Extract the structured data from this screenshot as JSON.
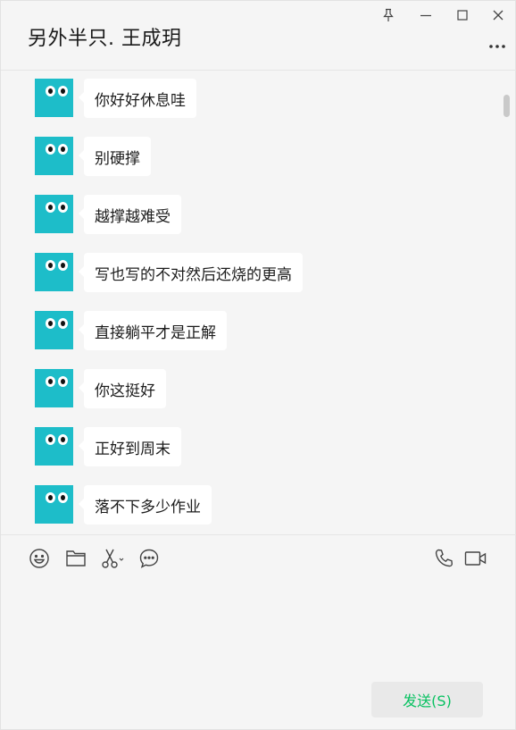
{
  "header": {
    "title": "另外半只. 王成玥",
    "pin_icon": "pin-icon",
    "minimize_icon": "minimize-icon",
    "maximize_icon": "maximize-icon",
    "close_icon": "close-icon",
    "more_icon": "more-icon"
  },
  "messages": [
    {
      "text": "你好好休息哇"
    },
    {
      "text": "别硬撑"
    },
    {
      "text": "越撑越难受"
    },
    {
      "text": "写也写的不对然后还烧的更高"
    },
    {
      "text": "直接躺平才是正解"
    },
    {
      "text": "你这挺好"
    },
    {
      "text": "正好到周末"
    },
    {
      "text": "落不下多少作业"
    }
  ],
  "toolbar": {
    "emoji_icon": "emoji-icon",
    "folder_icon": "folder-icon",
    "screenshot_icon": "scissors-icon",
    "chat_history_icon": "chat-bubble-icon",
    "voice_call_icon": "phone-icon",
    "video_call_icon": "video-camera-icon"
  },
  "input": {
    "value": ""
  },
  "send_button": {
    "label": "发送(S)"
  },
  "colors": {
    "avatar": "#1dbdc9",
    "send_text": "#07c160",
    "background": "#f5f5f5"
  }
}
